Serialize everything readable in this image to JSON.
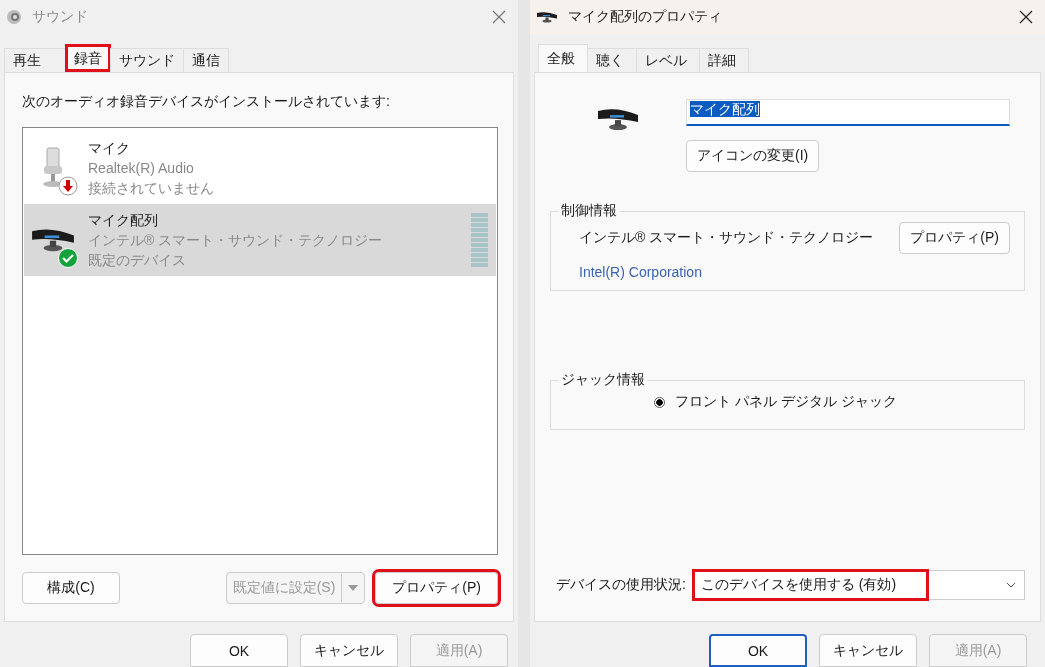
{
  "left_window": {
    "title": "サウンド",
    "tabs": [
      {
        "label": "再生",
        "selected": false,
        "highlighted": false
      },
      {
        "label": "録音",
        "selected": true,
        "highlighted": true
      },
      {
        "label": "サウンド",
        "selected": false,
        "highlighted": false
      },
      {
        "label": "通信",
        "selected": false,
        "highlighted": false
      }
    ],
    "instruction": "次のオーディオ録音デバイスがインストールされています:",
    "devices": [
      {
        "kind": "mic",
        "name": "マイク",
        "driver": "Realtek(R) Audio",
        "status": "接続されていません",
        "connected": false,
        "default": false,
        "selected": false
      },
      {
        "kind": "array",
        "name": "マイク配列",
        "driver": "インテル® スマート・サウンド・テクノロジー",
        "status": "既定のデバイス",
        "connected": true,
        "default": true,
        "selected": true
      }
    ],
    "buttons": [
      {
        "kind": "plain",
        "label": "構成(C)",
        "disabled": false,
        "highlighted": false
      },
      {
        "kind": "split",
        "label": "既定値に設定(S)",
        "disabled": true,
        "highlighted": false
      },
      {
        "kind": "plain",
        "label": "プロパティ(P)",
        "disabled": false,
        "highlighted": true
      }
    ],
    "footer": [
      {
        "label": "OK",
        "disabled": false,
        "default": false
      },
      {
        "label": "キャンセル",
        "disabled": false,
        "default": false
      },
      {
        "label": "適用(A)",
        "disabled": true,
        "default": false
      }
    ]
  },
  "right_window": {
    "title": "マイク配列のプロパティ",
    "tabs": [
      {
        "label": "全般",
        "selected": true
      },
      {
        "label": "聴く",
        "selected": false
      },
      {
        "label": "レベル",
        "selected": false
      },
      {
        "label": "詳細",
        "selected": false
      }
    ],
    "name_field": {
      "value": "マイク配列"
    },
    "change_icon_button": "アイコンの変更(I)",
    "controller": {
      "legend": "制御情報",
      "name": "インテル® スマート・サウンド・テクノロジー",
      "button": "プロパティ(P)",
      "vendor": "Intel(R) Corporation"
    },
    "jack": {
      "legend": "ジャック情報",
      "items": [
        {
          "label": "フロント パネル デジタル ジャック",
          "checked": true
        }
      ]
    },
    "usage": {
      "label": "デバイスの使用状況:",
      "value": "このデバイスを使用する (有効)",
      "highlighted": true
    },
    "footer": [
      {
        "label": "OK",
        "disabled": false,
        "default": true
      },
      {
        "label": "キャンセル",
        "disabled": false,
        "default": false
      },
      {
        "label": "適用(A)",
        "disabled": true,
        "default": false
      }
    ]
  }
}
